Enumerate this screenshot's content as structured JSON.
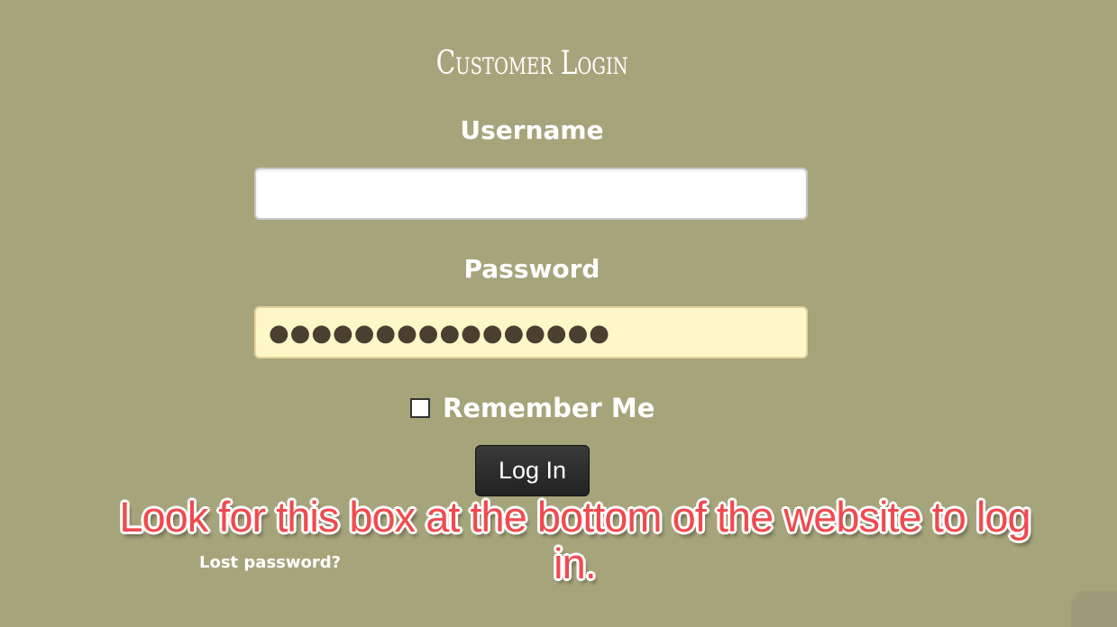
{
  "login": {
    "title": "Customer Login",
    "username_label": "Username",
    "username_value": "",
    "password_label": "Password",
    "password_masked": "●●●●●●●●●●●●●●●●",
    "remember_label": "Remember Me",
    "remember_checked": false,
    "submit_label": "Log In",
    "lost_password_label": "Lost password?"
  },
  "annotation": {
    "text": "Look for this box at the bottom of the website to log in.",
    "color": "#f04a4f"
  },
  "colors": {
    "background": "#a6a47b",
    "password_field_bg": "#fff7c8",
    "button_bg": "#2b2b2b"
  }
}
